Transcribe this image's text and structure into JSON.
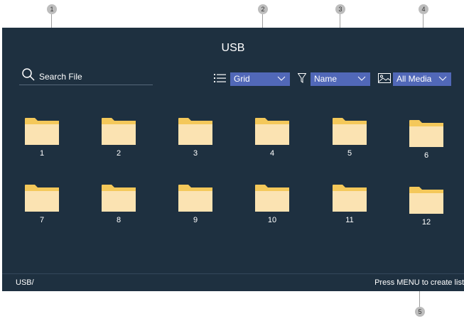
{
  "callouts": [
    "1",
    "2",
    "3",
    "4",
    "5"
  ],
  "header": {
    "title": "USB"
  },
  "search": {
    "label": "Search File"
  },
  "toolbar": {
    "view": {
      "label": "Grid",
      "icon": "list-icon"
    },
    "sort": {
      "label": "Name",
      "icon": "filter-icon"
    },
    "media": {
      "label": "All Media",
      "icon": "image-icon"
    }
  },
  "folders": [
    "1",
    "2",
    "3",
    "4",
    "5",
    "6",
    "7",
    "8",
    "9",
    "10",
    "11",
    "12"
  ],
  "footer": {
    "path": "USB/",
    "hint": "Press MENU to create list"
  },
  "colors": {
    "screen_bg": "#1e3040",
    "dropdown_bg": "#5168b8",
    "folder_back": "#f4c85a",
    "folder_front": "#fbe3b2"
  }
}
